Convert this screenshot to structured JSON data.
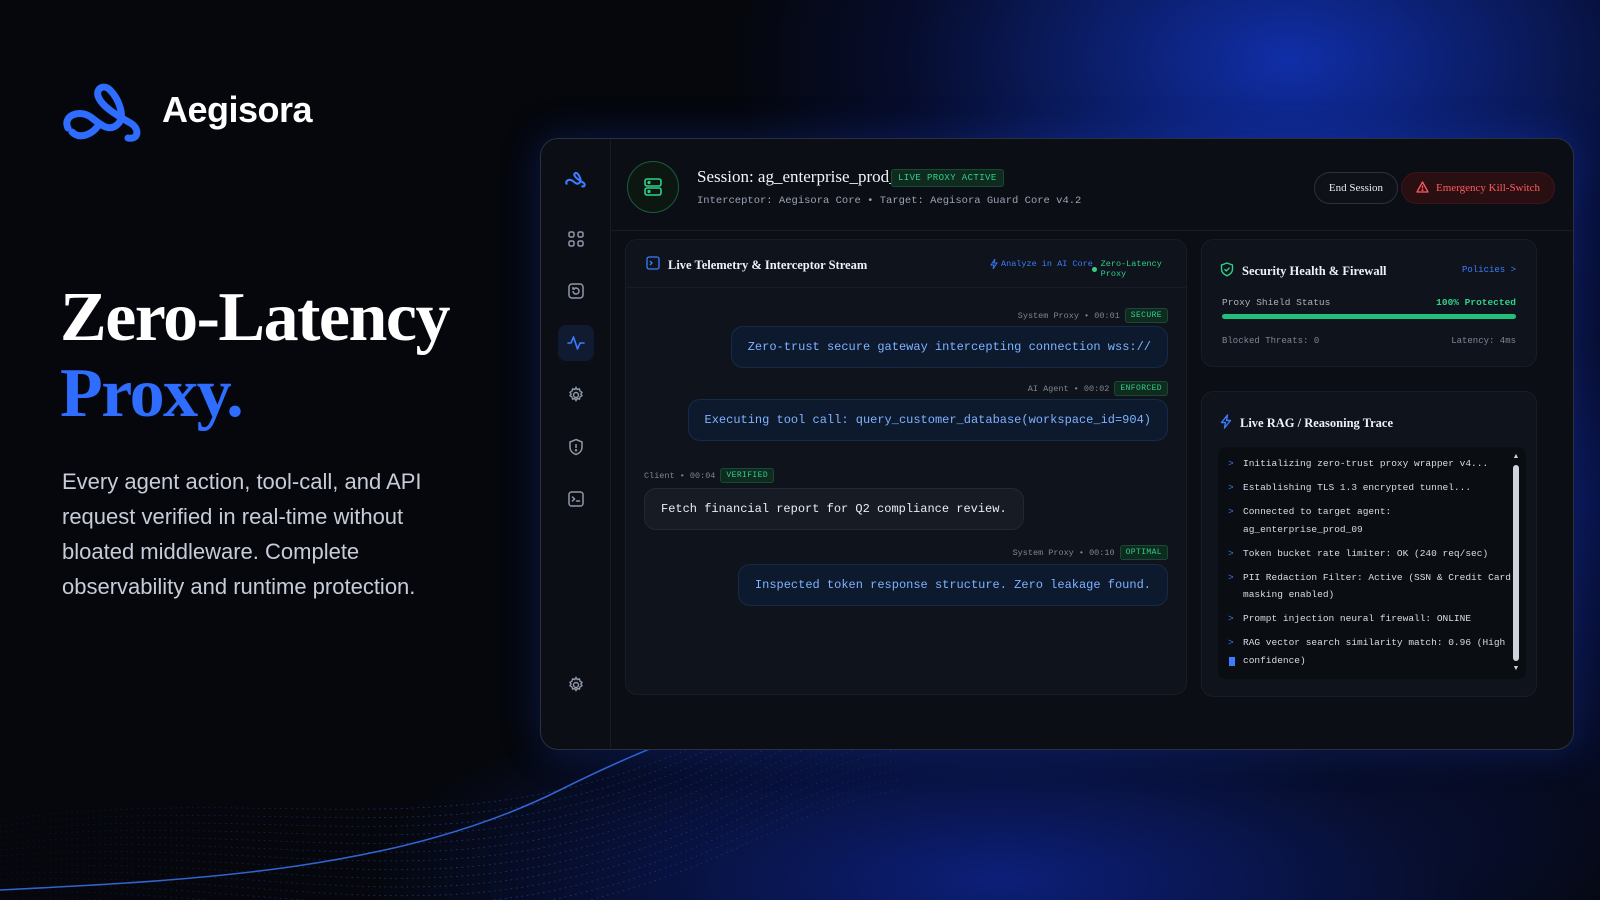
{
  "brand": {
    "name": "Aegisora",
    "logo_icon": "aegisora-logo-icon",
    "accent": "#2e6dff"
  },
  "hero": {
    "title_line1": "Zero-Latency",
    "title_line2": "Proxy.",
    "description": "Every agent action, tool-call, and API request verified in real-time without bloated middleware. Complete observability and runtime protection."
  },
  "sidebar": {
    "items": [
      {
        "icon": "logo-icon",
        "active": false
      },
      {
        "icon": "grid-icon",
        "active": false
      },
      {
        "icon": "replay-icon",
        "active": false
      },
      {
        "icon": "activity-icon",
        "active": true
      },
      {
        "icon": "gear-icon",
        "active": false
      },
      {
        "icon": "shield-icon",
        "active": false
      },
      {
        "icon": "terminal-icon",
        "active": false
      },
      {
        "icon": "settings-icon",
        "active": false
      }
    ]
  },
  "session": {
    "title": "Session: ag_enterprise_prod_09",
    "badge": "LIVE PROXY ACTIVE",
    "subtitle": "Interceptor: Aegisora Core • Target: Aegisora Guard Core v4.2",
    "end_label": "End Session",
    "kill_label": "Emergency Kill-Switch"
  },
  "telemetry": {
    "title": "Live Telemetry & Interceptor Stream",
    "analyze_label": "Analyze in AI Core",
    "status_label": "Zero-Latency Proxy",
    "messages": [
      {
        "meta": "System Proxy • 00:01",
        "badge": "SECURE",
        "text": "Zero-trust secure gateway intercepting connection wss://"
      },
      {
        "meta": "AI Agent • 00:02",
        "badge": "ENFORCED",
        "text": "Executing tool call: query_customer_database(workspace_id=904)"
      },
      {
        "meta": "Client • 00:04",
        "badge": "VERIFIED",
        "text": "Fetch financial report for Q2 compliance review."
      },
      {
        "meta": "System Proxy • 00:10",
        "badge": "OPTIMAL",
        "text": "Inspected token response structure. Zero leakage found."
      }
    ]
  },
  "security": {
    "title": "Security Health & Firewall",
    "policies_label": "Policies >",
    "shield_label": "Proxy Shield Status",
    "shield_value": "100% Protected",
    "shield_fraction": 1.0,
    "blocked": "Blocked Threats: 0",
    "latency": "Latency: 4ms"
  },
  "rag": {
    "title": "Live RAG / Reasoning Trace",
    "prompt": ">",
    "lines": [
      "Initializing zero-trust proxy wrapper v4...",
      "Establishing TLS 1.3 encrypted tunnel...",
      "Connected to target agent: ag_enterprise_prod_09",
      "Token bucket rate limiter: OK (240 req/sec)",
      "PII Redaction Filter: Active (SSN & Credit Card masking enabled)",
      "Prompt injection neural firewall: ONLINE",
      "RAG vector search similarity match: 0.96 (High confidence)"
    ]
  },
  "colors": {
    "accent_blue": "#3d7bff",
    "status_green": "#2fd08a",
    "danger_red": "#ff5a5f"
  }
}
